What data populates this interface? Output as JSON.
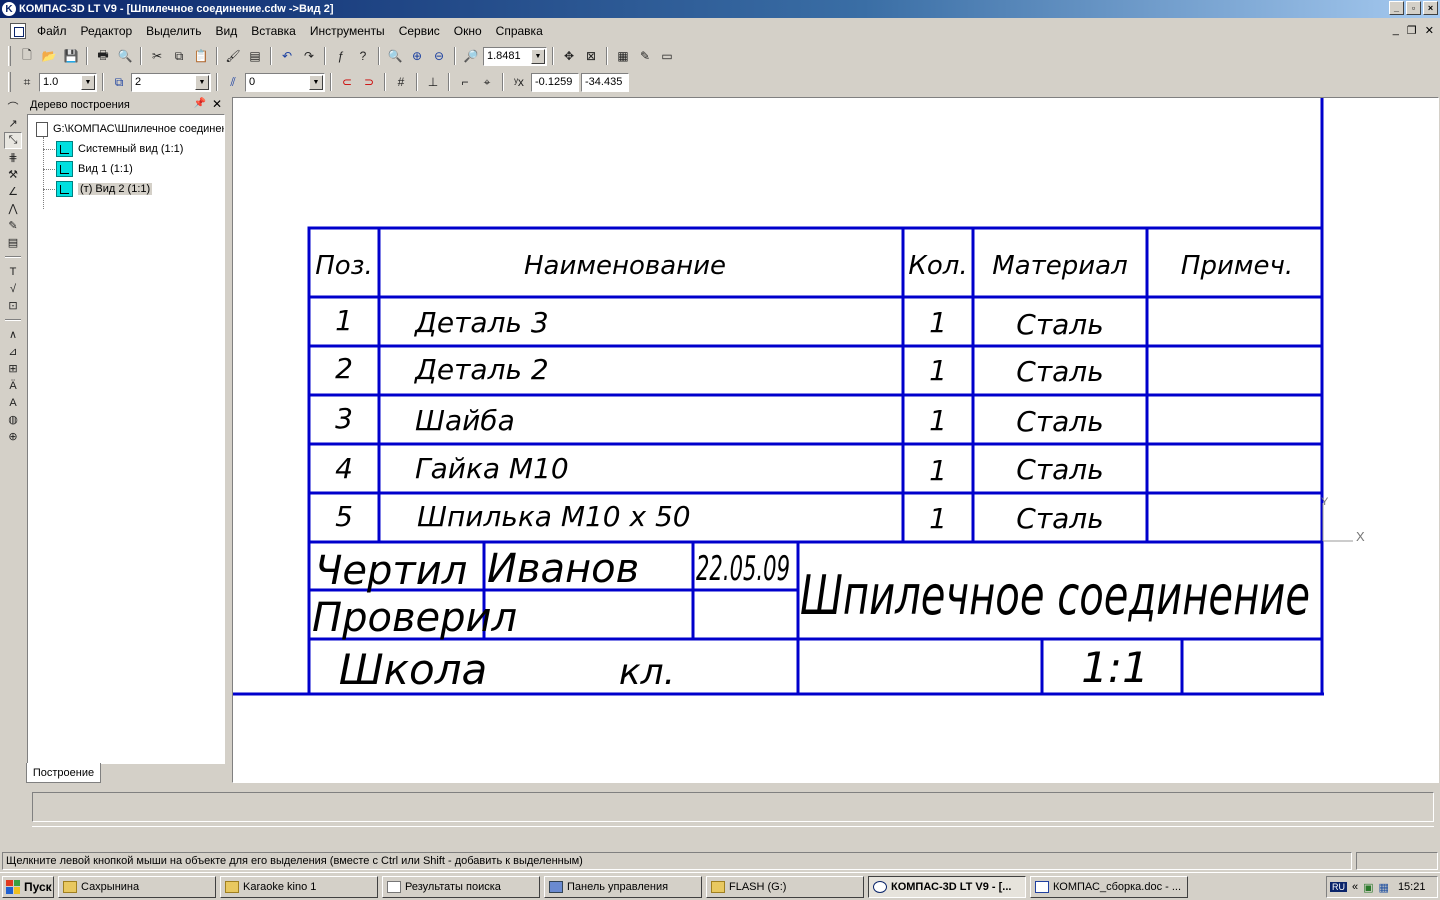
{
  "window": {
    "title": "КОМПАС-3D LT V9 - [Шпилечное соединение.cdw ->Вид 2]",
    "app_icon_letter": "K"
  },
  "menu": [
    "Файл",
    "Редактор",
    "Выделить",
    "Вид",
    "Вставка",
    "Инструменты",
    "Сервис",
    "Окно",
    "Справка"
  ],
  "toolbar": {
    "zoom_value": "1.8481",
    "step_value": "1.0",
    "layer_value": "2",
    "style_value": "0",
    "coord_x": "-0.1259",
    "coord_y": "-34.435"
  },
  "tree": {
    "header": "Дерево построения",
    "root": "G:\\КОМПАС\\Шпилечное соединение",
    "items": [
      "Системный вид (1:1)",
      "Вид 1 (1:1)",
      "(т) Вид 2 (1:1)"
    ],
    "tab": "Построение"
  },
  "drawing": {
    "header": [
      "Поз.",
      "Наименование",
      "Кол.",
      "Материал",
      "Примеч."
    ],
    "rows": [
      {
        "pos": "1",
        "name": "Деталь 3",
        "qty": "1",
        "material": "Сталь"
      },
      {
        "pos": "2",
        "name": "Деталь 2",
        "qty": "1",
        "material": "Сталь"
      },
      {
        "pos": "3",
        "name": "Шайба",
        "qty": "1",
        "material": "Сталь"
      },
      {
        "pos": "4",
        "name": "Гайка М10",
        "qty": "1",
        "material": "Сталь"
      },
      {
        "pos": "5",
        "name": "Шпилька М10 х 50",
        "qty": "1",
        "material": "Сталь"
      }
    ],
    "stamp": {
      "drew_label": "Чертил",
      "drew_name": "Иванов",
      "date": "22.05.09",
      "checked_label": "Проверил",
      "title": "Шпилечное соединение",
      "school": "Школа",
      "class": "кл.",
      "scale": "1:1"
    },
    "axis_y": "Y",
    "axis_x": "X",
    "line_color": "#0000cc"
  },
  "status": {
    "message": "Щелкните левой кнопкой мыши на объекте для его выделения (вместе с Ctrl или Shift - добавить к выделенным)"
  },
  "taskbar": {
    "start": "Пуск",
    "tasks": [
      {
        "label": "Сахрынина",
        "active": false
      },
      {
        "label": "Karaoke kino 1",
        "active": false
      },
      {
        "label": "Результаты поиска",
        "active": false
      },
      {
        "label": "Панель управления",
        "active": false
      },
      {
        "label": "FLASH (G:)",
        "active": false
      },
      {
        "label": "КОМПАС-3D LT V9 - [...",
        "active": true
      },
      {
        "label": "КОМПАС_сборка.doc - ...",
        "active": false
      }
    ],
    "tray_lang": "RU",
    "tray_chevron": "«",
    "clock": "15:21"
  }
}
